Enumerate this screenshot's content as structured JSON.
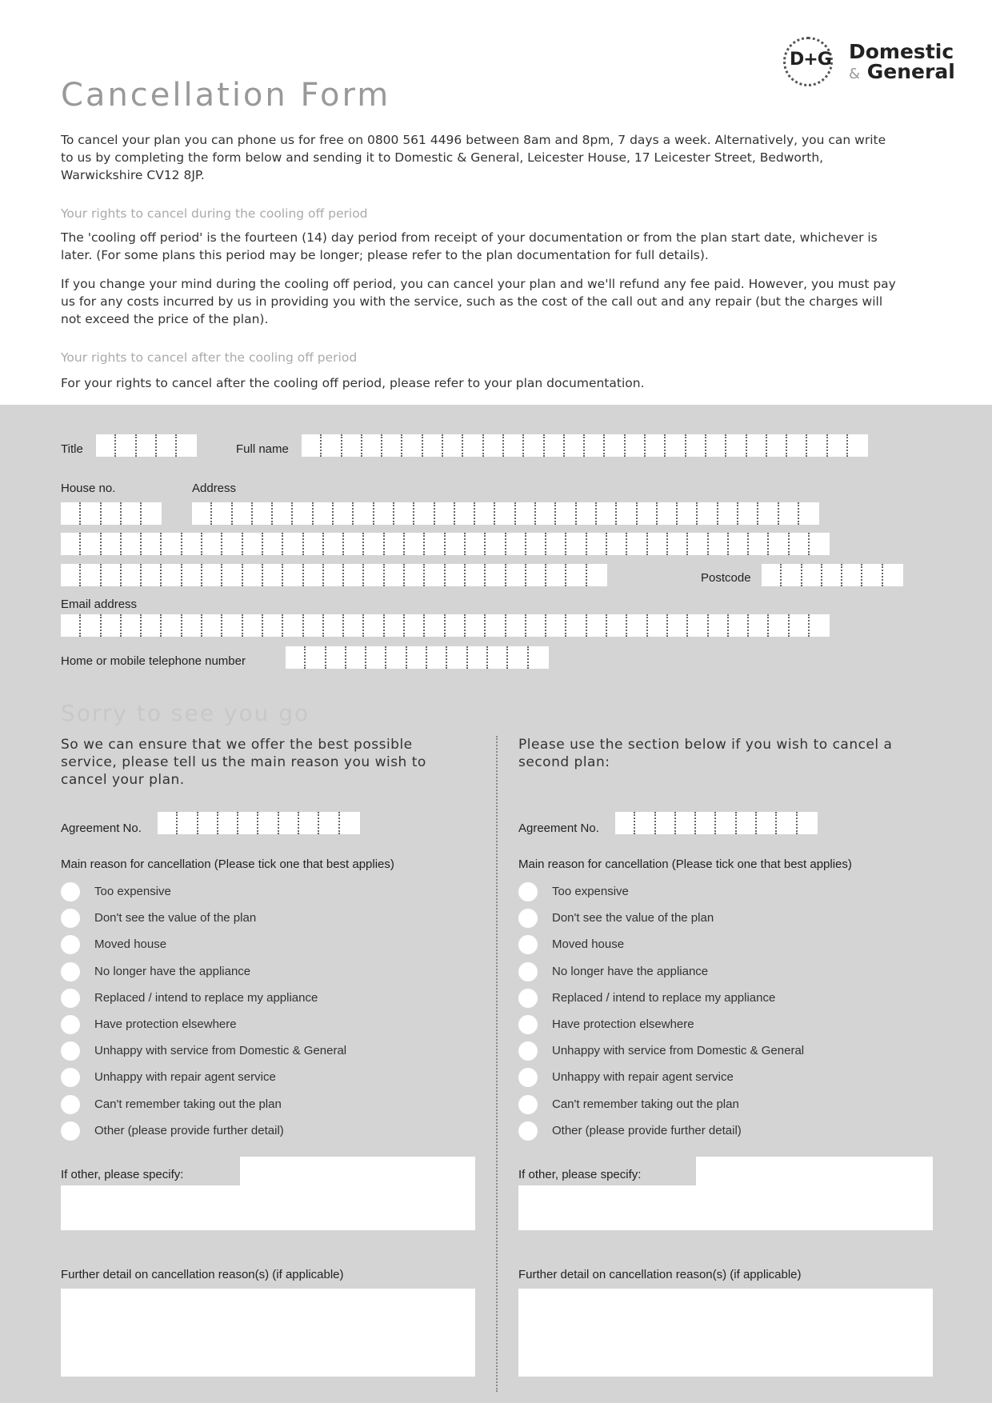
{
  "brand": {
    "monogram": "D+G",
    "name_line1": "Domestic",
    "name_amp": "&",
    "name_line2": "General"
  },
  "title": "Cancellation Form",
  "intro": "To cancel your plan you can phone us for free on 0800 561 4496 between 8am and 8pm, 7 days a week. Alternatively, you can write to us by completing the form below and sending it to Domestic & General, Leicester House, 17 Leicester Street, Bedworth, Warwickshire CV12 8JP.",
  "cooling_off": {
    "heading": "Your rights to cancel during the cooling off period",
    "para1": "The 'cooling off period' is the fourteen (14) day period from receipt of your documentation or from the plan start date, whichever is later. (For some plans this period may be longer; please refer to the plan documentation for full details).",
    "para2": "If you change your mind during the cooling off period, you can cancel your plan and we'll refund any fee paid. However, you must pay us for any costs incurred by us in providing you with the service, such as the cost of the call out and any repair (but the charges will not exceed the price of the plan)."
  },
  "after_cooling_off": {
    "heading": "Your rights to cancel after the cooling off period",
    "para": "For your rights to cancel after the cooling off period, please refer to your plan documentation."
  },
  "form": {
    "title_label": "Title",
    "fullname_label": "Full name",
    "house_label": "House no.",
    "address_label": "Address",
    "postcode_label": "Postcode",
    "email_label": "Email address",
    "phone_label": "Home or mobile telephone number"
  },
  "sorry": {
    "heading": "Sorry to see you go",
    "left_intro": "So we can ensure that we offer the best possible service, please tell us the main reason you wish to cancel your plan.",
    "right_intro": "Please use the section below if you wish to cancel a second plan:",
    "agreement_label": "Agreement No.",
    "reason_heading_left": "Main reason for cancellation (Please tick one that best applies)",
    "reason_heading_right": "Main reason for cancellation  (Please tick one that best applies)",
    "reasons": [
      "Too expensive",
      "Don't see the value of the plan",
      "Moved house",
      "No longer have the appliance",
      "Replaced / intend to replace my appliance",
      "Have protection elsewhere",
      "Unhappy with service from Domestic & General",
      "Unhappy with repair agent service",
      "Can't remember taking out the plan",
      "Other (please provide further detail)"
    ],
    "other_label": "If other, please specify:",
    "further_label": "Further detail on cancellation reason(s) (if applicable)"
  }
}
